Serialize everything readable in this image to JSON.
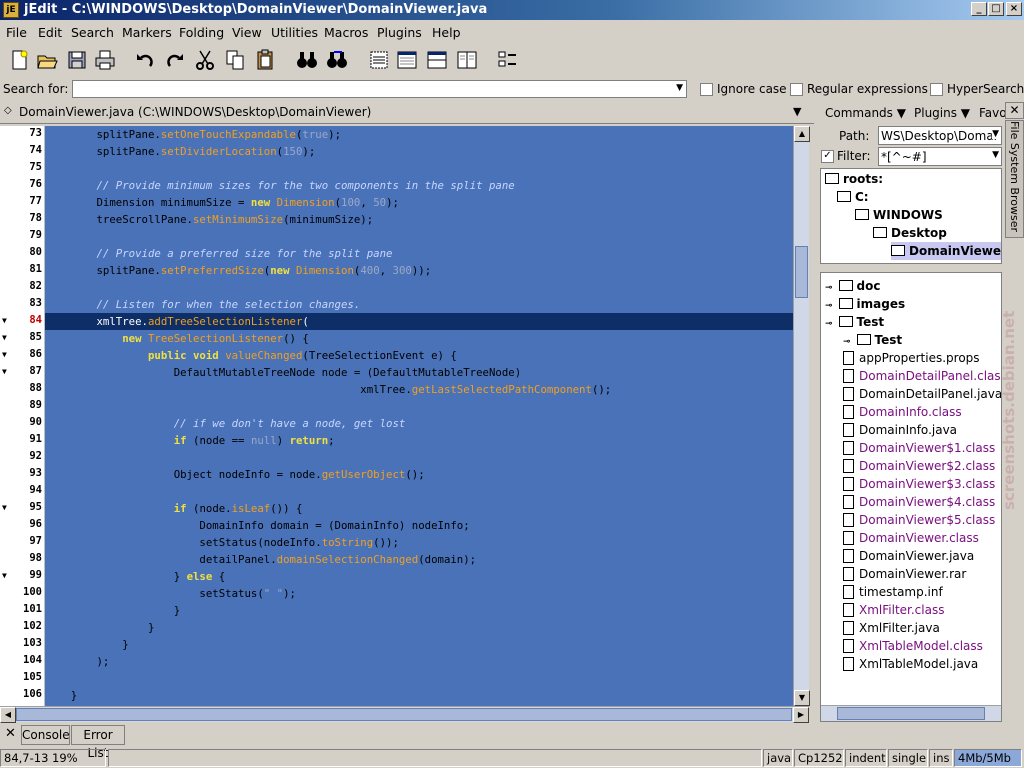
{
  "window": {
    "title": "jEdit - C:\\WINDOWS\\Desktop\\DomainViewer\\DomainViewer.java",
    "app_icon": "jE"
  },
  "menus": [
    "File",
    "Edit",
    "Search",
    "Markers",
    "Folding",
    "View",
    "Utilities",
    "Macros",
    "Plugins",
    "Help"
  ],
  "toolbar": [
    "new-file-icon",
    "open-file-icon",
    "save-icon",
    "print-icon",
    "undo-icon",
    "redo-icon",
    "cut-icon",
    "copy-icon",
    "paste-icon",
    "find-icon",
    "find-next-icon",
    "split-horizontal-icon",
    "unsplit-icon",
    "split-vertical-icon",
    "vertical-split-icon",
    "buffer-options-icon"
  ],
  "search": {
    "label": "Search for:",
    "value": "",
    "ignore_case": "Ignore case",
    "regex": "Regular expressions",
    "hypersearch": "HyperSearch"
  },
  "editor": {
    "buffer_label": "DomainViewer.java (C:\\WINDOWS\\Desktop\\DomainViewer)",
    "lines": [
      {
        "n": "73",
        "t": "        splitPane.setOneTouchExpandable(true);"
      },
      {
        "n": "74",
        "t": "        splitPane.setDividerLocation(150);"
      },
      {
        "n": "75",
        "t": ""
      },
      {
        "n": "76",
        "t": "        // Provide minimum sizes for the two components in the split pane"
      },
      {
        "n": "77",
        "t": "        Dimension minimumSize = new Dimension(100, 50);"
      },
      {
        "n": "78",
        "t": "        treeScrollPane.setMinimumSize(minimumSize);"
      },
      {
        "n": "79",
        "t": ""
      },
      {
        "n": "80",
        "t": "        // Provide a preferred size for the split pane"
      },
      {
        "n": "81",
        "t": "        splitPane.setPreferredSize(new Dimension(400, 300));"
      },
      {
        "n": "82",
        "t": ""
      },
      {
        "n": "83",
        "t": "        // Listen for when the selection changes."
      },
      {
        "n": "84",
        "t": "        xmlTree.addTreeSelectionListener("
      },
      {
        "n": "85",
        "t": "            new TreeSelectionListener() {"
      },
      {
        "n": "86",
        "t": "                public void valueChanged(TreeSelectionEvent e) {"
      },
      {
        "n": "87",
        "t": "                    DefaultMutableTreeNode node = (DefaultMutableTreeNode)"
      },
      {
        "n": "88",
        "t": "                                                 xmlTree.getLastSelectedPathComponent();"
      },
      {
        "n": "89",
        "t": ""
      },
      {
        "n": "90",
        "t": "                    // if we don't have a node, get lost"
      },
      {
        "n": "91",
        "t": "                    if (node == null) return;"
      },
      {
        "n": "92",
        "t": ""
      },
      {
        "n": "93",
        "t": "                    Object nodeInfo = node.getUserObject();"
      },
      {
        "n": "94",
        "t": ""
      },
      {
        "n": "95",
        "t": "                    if (node.isLeaf()) {"
      },
      {
        "n": "96",
        "t": "                        DomainInfo domain = (DomainInfo) nodeInfo;"
      },
      {
        "n": "97",
        "t": "                        setStatus(nodeInfo.toString());"
      },
      {
        "n": "98",
        "t": "                        detailPanel.domainSelectionChanged(domain);"
      },
      {
        "n": "99",
        "t": "                    } else {"
      },
      {
        "n": "100",
        "t": "                        setStatus(\" \");"
      },
      {
        "n": "101",
        "t": "                    }"
      },
      {
        "n": "102",
        "t": "                }"
      },
      {
        "n": "103",
        "t": "            }"
      },
      {
        "n": "104",
        "t": "        );"
      },
      {
        "n": "105",
        "t": ""
      },
      {
        "n": "106",
        "t": "    }"
      }
    ],
    "fold_lines": [
      "84",
      "85",
      "86",
      "87",
      "95",
      "99"
    ],
    "current_line": "84"
  },
  "right_panel": {
    "menus": [
      "Commands",
      "Plugins",
      "Favo"
    ],
    "path_label": "Path:",
    "path_value": "WS\\Desktop\\Domai",
    "filter_label": "Filter:",
    "filter_value": "*[^~#]",
    "vtab_label": "File System Browser",
    "roots": [
      "roots:",
      "C:",
      "WINDOWS",
      "Desktop",
      "DomainViewer"
    ],
    "files": [
      {
        "name": "doc",
        "type": "folder"
      },
      {
        "name": "images",
        "type": "folder"
      },
      {
        "name": "Test",
        "type": "folder-open"
      },
      {
        "name": "Test",
        "type": "subfolder"
      },
      {
        "name": "appProperties.props",
        "type": "file"
      },
      {
        "name": "DomainDetailPanel.class",
        "type": "class"
      },
      {
        "name": "DomainDetailPanel.java",
        "type": "java"
      },
      {
        "name": "DomainInfo.class",
        "type": "class"
      },
      {
        "name": "DomainInfo.java",
        "type": "java"
      },
      {
        "name": "DomainViewer$1.class",
        "type": "class"
      },
      {
        "name": "DomainViewer$2.class",
        "type": "class"
      },
      {
        "name": "DomainViewer$3.class",
        "type": "class"
      },
      {
        "name": "DomainViewer$4.class",
        "type": "class"
      },
      {
        "name": "DomainViewer$5.class",
        "type": "class"
      },
      {
        "name": "DomainViewer.class",
        "type": "class"
      },
      {
        "name": "DomainViewer.java",
        "type": "java"
      },
      {
        "name": "DomainViewer.rar",
        "type": "file"
      },
      {
        "name": "timestamp.inf",
        "type": "file"
      },
      {
        "name": "XmlFilter.class",
        "type": "class"
      },
      {
        "name": "XmlFilter.java",
        "type": "file"
      },
      {
        "name": "XmlTableModel.class",
        "type": "class"
      },
      {
        "name": "XmlTableModel.java",
        "type": "file"
      }
    ]
  },
  "bottom_tabs": [
    "Console",
    "Error List"
  ],
  "status": {
    "position": "84,7-13 19%",
    "mode": "java",
    "encoding": "Cp1252",
    "indent": "indent",
    "line_sep": "single",
    "ins": "ins",
    "memory": "4Mb/5Mb"
  },
  "watermark": "screenshots.debian.net",
  "colors": {
    "editor_bg": "#4a72b8",
    "current_line": "#0d2e66",
    "keyword": "#f0e040",
    "method": "#f0a020",
    "class_file": "#7a1080"
  }
}
